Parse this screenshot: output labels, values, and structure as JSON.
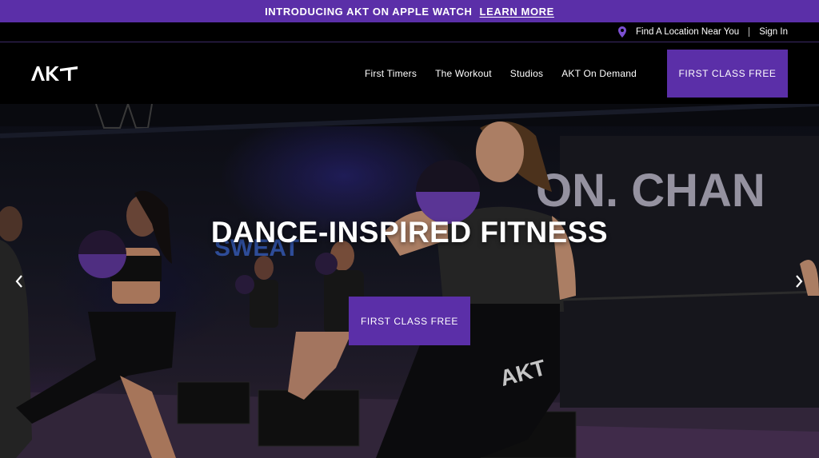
{
  "promo": {
    "text": "INTRODUCING AKT ON APPLE WATCH",
    "link_label": "LEARN MORE"
  },
  "utility": {
    "location_icon": "map-pin-icon",
    "find_location": "Find A Location Near You",
    "sign_in": "Sign In"
  },
  "nav": {
    "logo_text": "AKT",
    "items": [
      {
        "label": "First Timers"
      },
      {
        "label": "The Workout"
      },
      {
        "label": "Studios"
      },
      {
        "label": "AKT On Demand"
      }
    ],
    "cta_label": "FIRST CLASS FREE"
  },
  "hero": {
    "title": "DANCE-INSPIRED FITNESS",
    "cta_label": "FIRST CLASS FREE",
    "prev_icon": "chevron-left-icon",
    "next_icon": "chevron-right-icon",
    "background_wall_text": "ON. CHAN",
    "background_neon_text": "SWEAT"
  },
  "colors": {
    "brand_purple": "#5b2fa8",
    "background": "#000000",
    "text": "#ffffff"
  }
}
